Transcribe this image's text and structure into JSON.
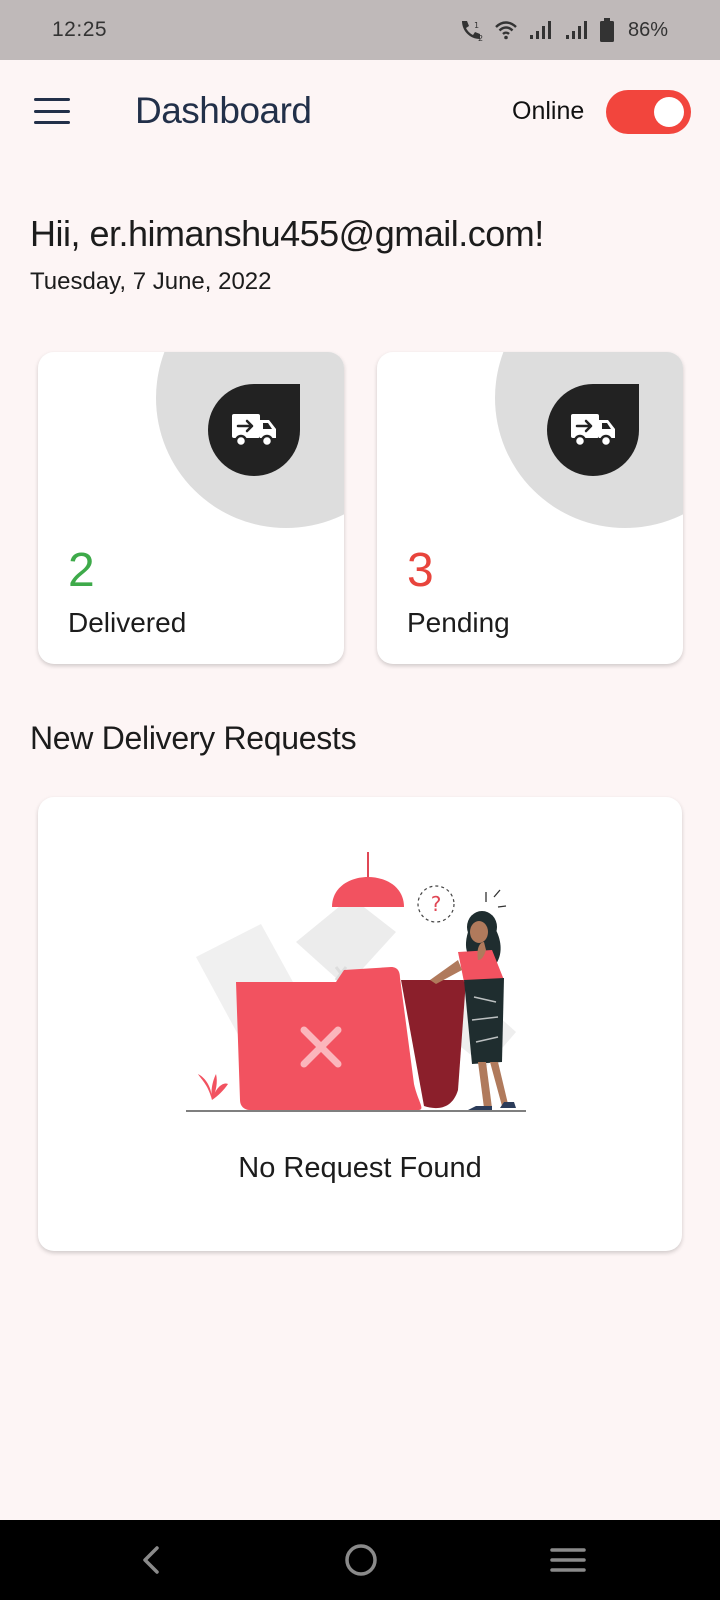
{
  "status_bar": {
    "time": "12:25",
    "battery": "86%",
    "icons": [
      "call-icon",
      "wifi-icon",
      "signal-icon",
      "signal-icon",
      "battery-icon"
    ]
  },
  "app_bar": {
    "title": "Dashboard",
    "menu_icon": "menu-icon",
    "online_label": "Online",
    "online_toggle_on": true
  },
  "greeting": {
    "text": "Hii, er.himanshu455@gmail.com!",
    "date": "Tuesday, 7 June, 2022"
  },
  "stats": {
    "delivered": {
      "value": "2",
      "label": "Delivered",
      "icon": "delivery-truck-icon",
      "color": "#3eaa4a"
    },
    "pending": {
      "value": "3",
      "label": "Pending",
      "icon": "delivery-truck-icon",
      "color": "#e8443c"
    }
  },
  "requests": {
    "section_title": "New Delivery Requests",
    "empty_text": "No Request Found",
    "illustration": "empty-folder-illustration"
  },
  "colors": {
    "accent": "#f2453d",
    "background": "#fdf5f5",
    "title": "#223049"
  },
  "nav_bar": {
    "icons": [
      "back-icon",
      "home-icon",
      "recents-icon"
    ]
  }
}
